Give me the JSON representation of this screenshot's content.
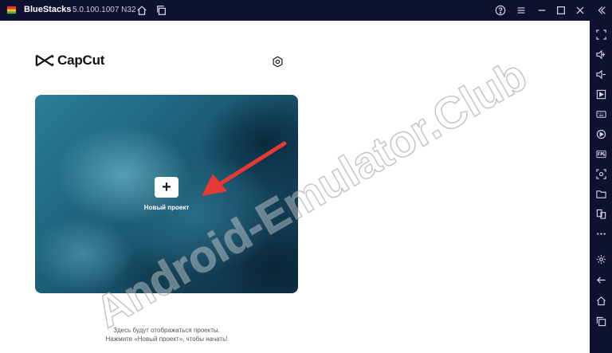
{
  "window": {
    "app_name": "BlueStacks",
    "version": "5.0.100.1007 N32"
  },
  "titlebar_icons": [
    "home-icon",
    "multi-instance-icon",
    "help-icon",
    "menu-icon",
    "minimize-icon",
    "maximize-icon",
    "close-icon",
    "collapse-sidebar-icon"
  ],
  "app": {
    "brand": "CapCut",
    "new_project_label": "Новый проект",
    "hint_line1": "Здесь будут отображаться проекты.",
    "hint_line2": "Нажмите «Новый проект», чтобы начать!"
  },
  "watermark": "Android-Emulator.Club",
  "sidebar_icons": [
    "fullscreen-icon",
    "volume-up-icon",
    "volume-down-icon",
    "play-store-icon",
    "keyboard-icon",
    "macro-icon",
    "fps-icon",
    "screenshot-icon",
    "folder-icon",
    "multi-instance-sync-icon",
    "more-icon",
    "settings-icon",
    "back-icon",
    "home-icon",
    "recent-apps-icon"
  ],
  "colors": {
    "frame": "#0f1130",
    "arrow": "#e53935"
  }
}
